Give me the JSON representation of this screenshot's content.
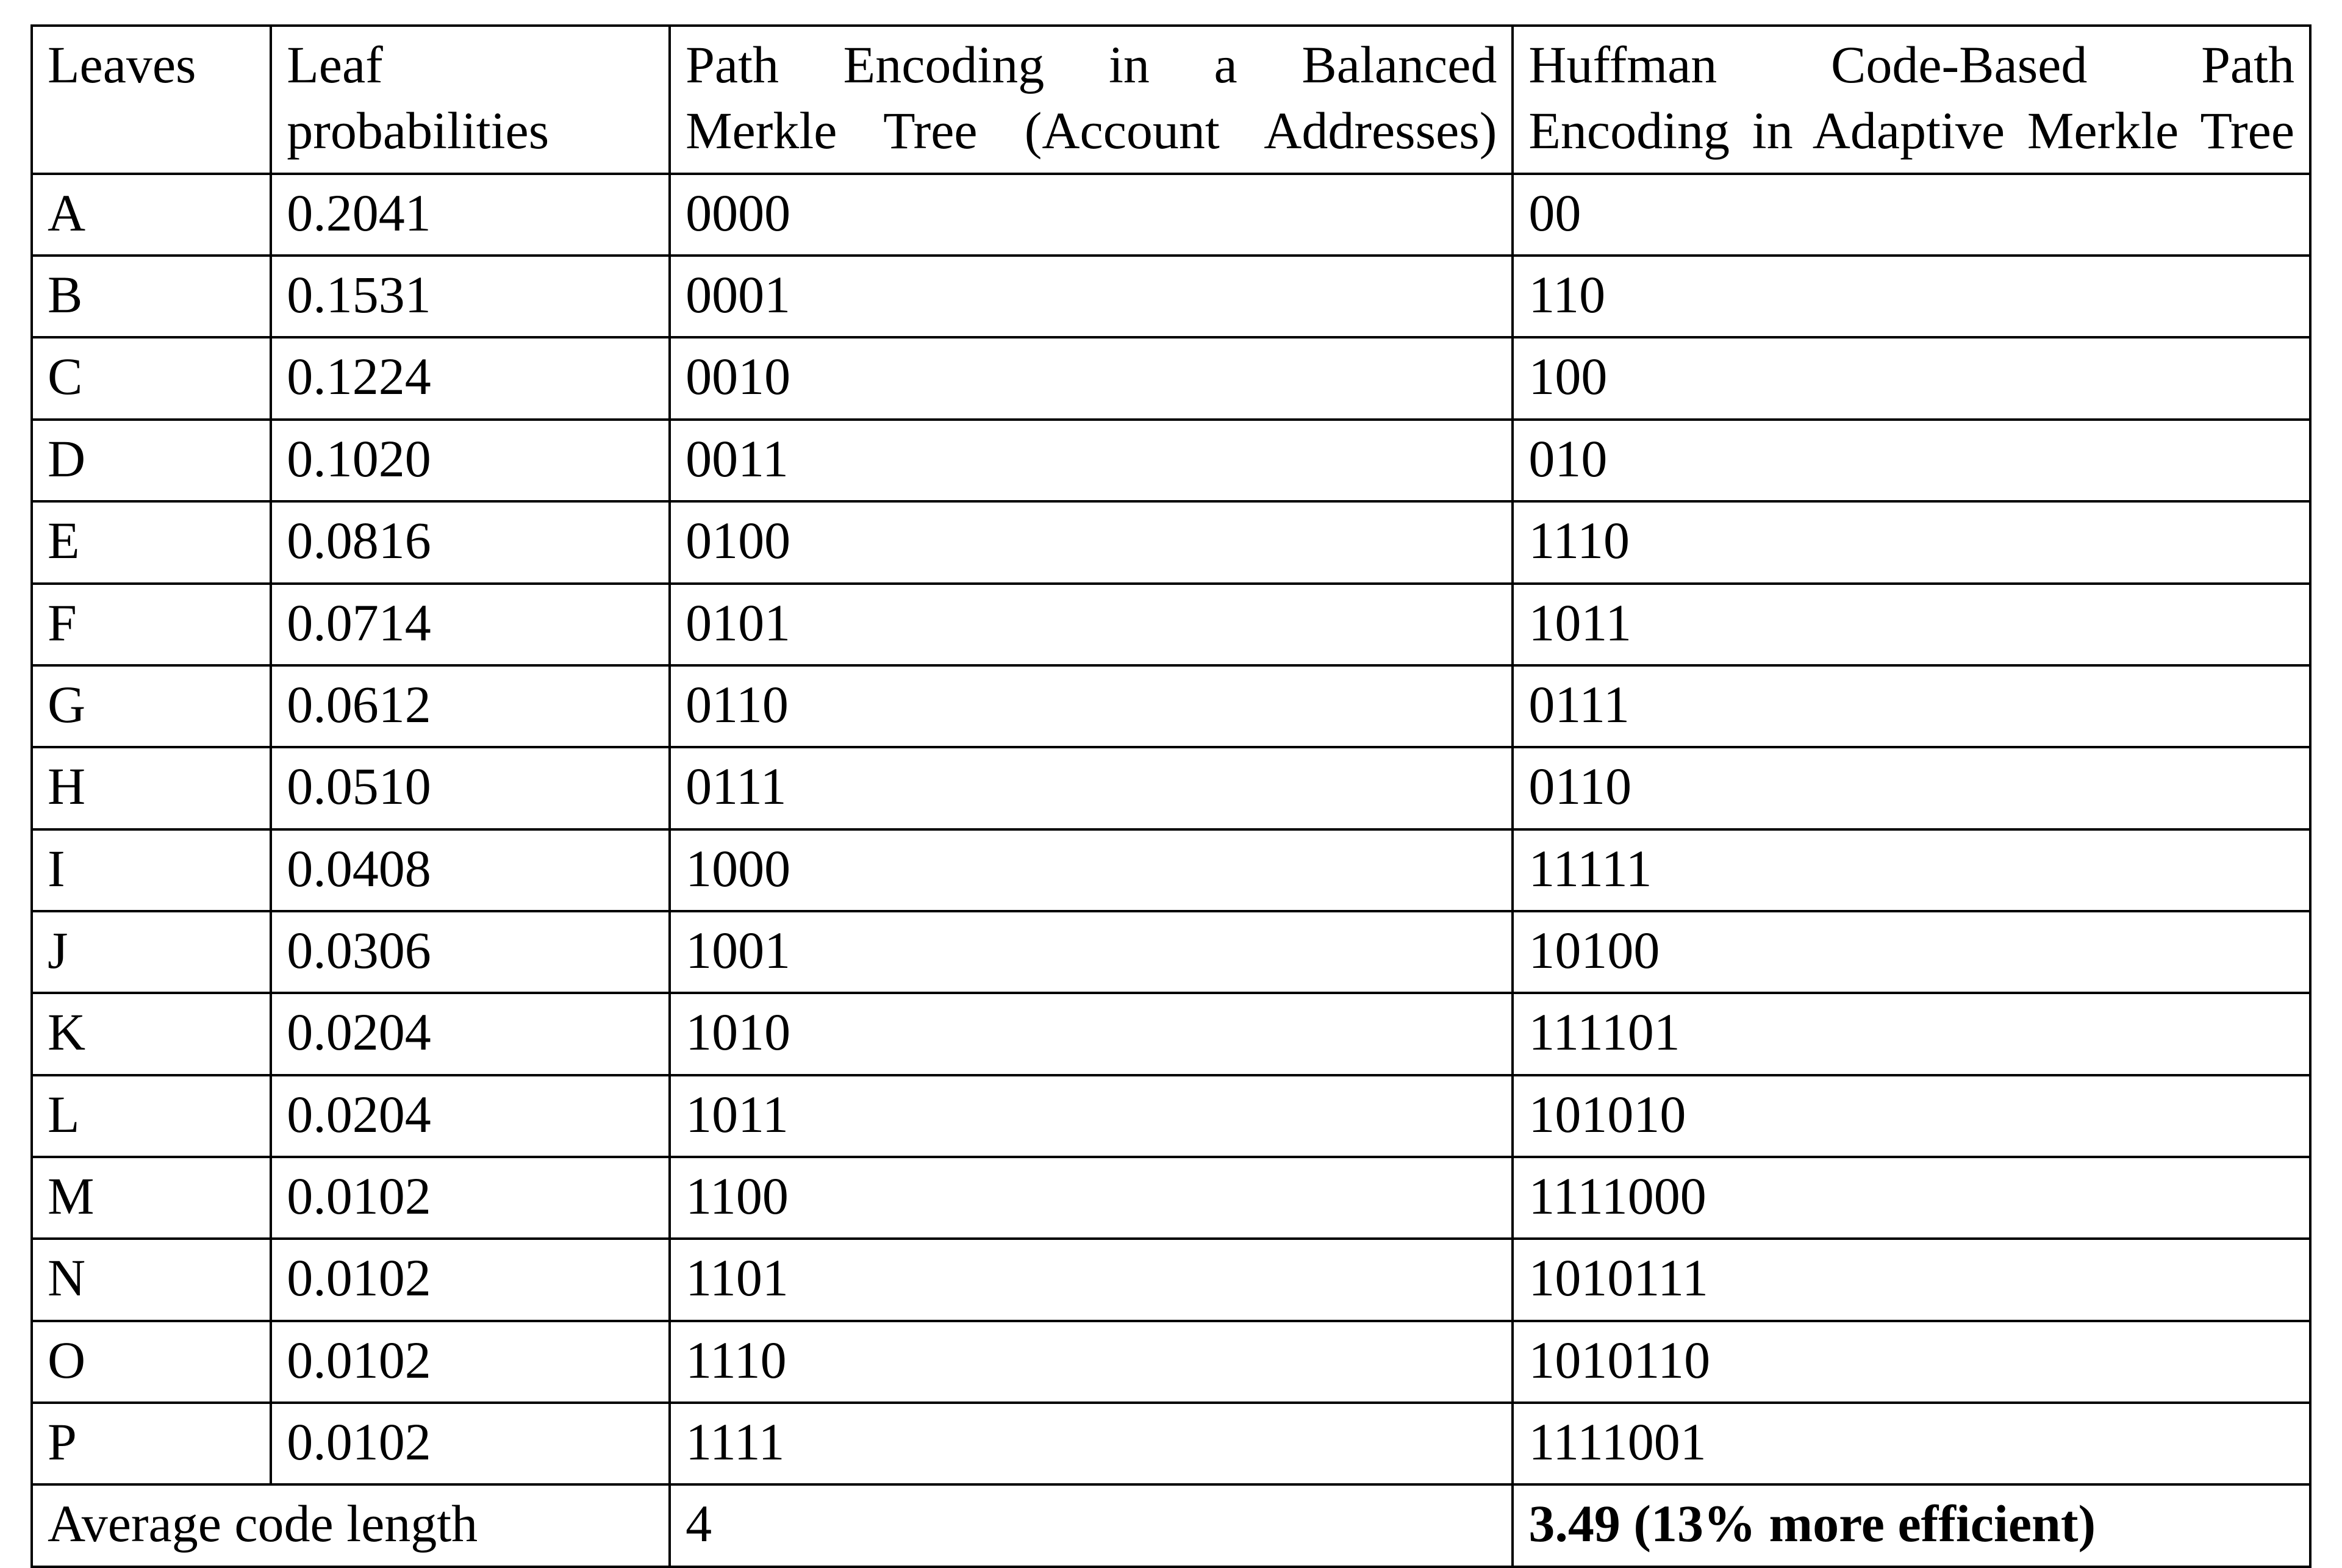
{
  "headers": {
    "leaves": "Leaves",
    "prob_l1": "Leaf",
    "prob_l2": "probabilities",
    "balanced_l1": "Path Encoding in a Balanced",
    "balanced_l2": "Merkle Tree (Account Addresses)",
    "huffman_l1": "Huffman Code-Based Path",
    "huffman_l2": "Encoding in Adaptive Merkle Tree"
  },
  "rows": [
    {
      "leaf": "A",
      "prob": "0.2041",
      "balanced": "0000",
      "huffman": "00"
    },
    {
      "leaf": "B",
      "prob": "0.1531",
      "balanced": "0001",
      "huffman": "110"
    },
    {
      "leaf": "C",
      "prob": "0.1224",
      "balanced": "0010",
      "huffman": "100"
    },
    {
      "leaf": "D",
      "prob": "0.1020",
      "balanced": "0011",
      "huffman": "010"
    },
    {
      "leaf": "E",
      "prob": "0.0816",
      "balanced": "0100",
      "huffman": "1110"
    },
    {
      "leaf": "F",
      "prob": "0.0714",
      "balanced": "0101",
      "huffman": "1011"
    },
    {
      "leaf": "G",
      "prob": "0.0612",
      "balanced": "0110",
      "huffman": "0111"
    },
    {
      "leaf": "H",
      "prob": "0.0510",
      "balanced": "0111",
      "huffman": "0110"
    },
    {
      "leaf": "I",
      "prob": "0.0408",
      "balanced": "1000",
      "huffman": "11111"
    },
    {
      "leaf": "J",
      "prob": "0.0306",
      "balanced": "1001",
      "huffman": "10100"
    },
    {
      "leaf": "K",
      "prob": "0.0204",
      "balanced": "1010",
      "huffman": "111101"
    },
    {
      "leaf": "L",
      "prob": "0.0204",
      "balanced": "1011",
      "huffman": "101010"
    },
    {
      "leaf": "M",
      "prob": "0.0102",
      "balanced": "1100",
      "huffman": "1111000"
    },
    {
      "leaf": "N",
      "prob": "0.0102",
      "balanced": "1101",
      "huffman": "1010111"
    },
    {
      "leaf": "O",
      "prob": "0.0102",
      "balanced": "1110",
      "huffman": "1010110"
    },
    {
      "leaf": "P",
      "prob": "0.0102",
      "balanced": "1111",
      "huffman": "1111001"
    }
  ],
  "footer": {
    "label": "Average code length",
    "balanced": "4",
    "huffman": "3.49 (13% more efficient)"
  },
  "chart_data": {
    "type": "table",
    "title": "Path encoding comparison: Balanced vs Huffman-coded Adaptive Merkle Tree",
    "columns": [
      "Leaves",
      "Leaf probabilities",
      "Balanced path encoding",
      "Huffman-based path encoding"
    ],
    "leaves": [
      "A",
      "B",
      "C",
      "D",
      "E",
      "F",
      "G",
      "H",
      "I",
      "J",
      "K",
      "L",
      "M",
      "N",
      "O",
      "P"
    ],
    "probabilities": [
      0.2041,
      0.1531,
      0.1224,
      0.102,
      0.0816,
      0.0714,
      0.0612,
      0.051,
      0.0408,
      0.0306,
      0.0204,
      0.0204,
      0.0102,
      0.0102,
      0.0102,
      0.0102
    ],
    "balanced_codes": [
      "0000",
      "0001",
      "0010",
      "0011",
      "0100",
      "0101",
      "0110",
      "0111",
      "1000",
      "1001",
      "1010",
      "1011",
      "1100",
      "1101",
      "1110",
      "1111"
    ],
    "huffman_codes": [
      "00",
      "110",
      "100",
      "010",
      "1110",
      "1011",
      "0111",
      "0110",
      "11111",
      "10100",
      "111101",
      "101010",
      "1111000",
      "1010111",
      "1010110",
      "1111001"
    ],
    "average_code_length": {
      "balanced": 4,
      "huffman": 3.49
    },
    "huffman_efficiency_gain_percent": 13
  }
}
